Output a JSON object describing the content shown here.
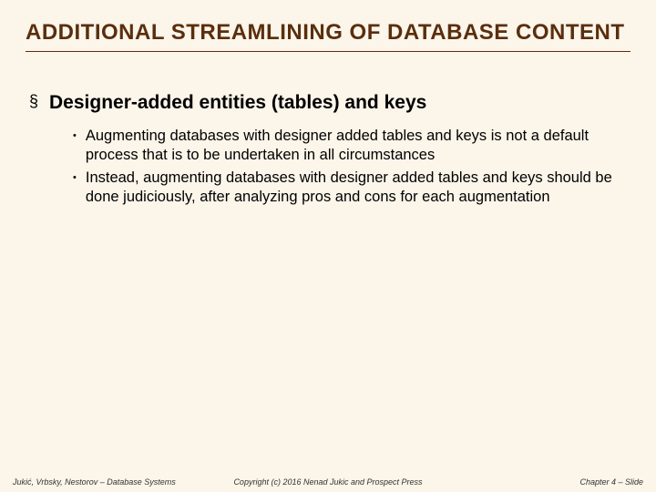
{
  "title": "ADDITIONAL STREAMLINING OF DATABASE CONTENT",
  "section": {
    "bullet": "§",
    "heading": "Designer-added entities (tables) and keys",
    "items": [
      "Augmenting databases with designer added tables and keys is not a default process that is to be undertaken in all circumstances",
      "Instead, augmenting databases with designer added tables and keys should be done judiciously, after analyzing pros and cons for each augmentation"
    ]
  },
  "footer": {
    "left": "Jukić, Vrbsky, Nestorov – Database Systems",
    "center": "Copyright (c) 2016 Nenad Jukic and Prospect Press",
    "right": "Chapter 4 – Slide"
  }
}
